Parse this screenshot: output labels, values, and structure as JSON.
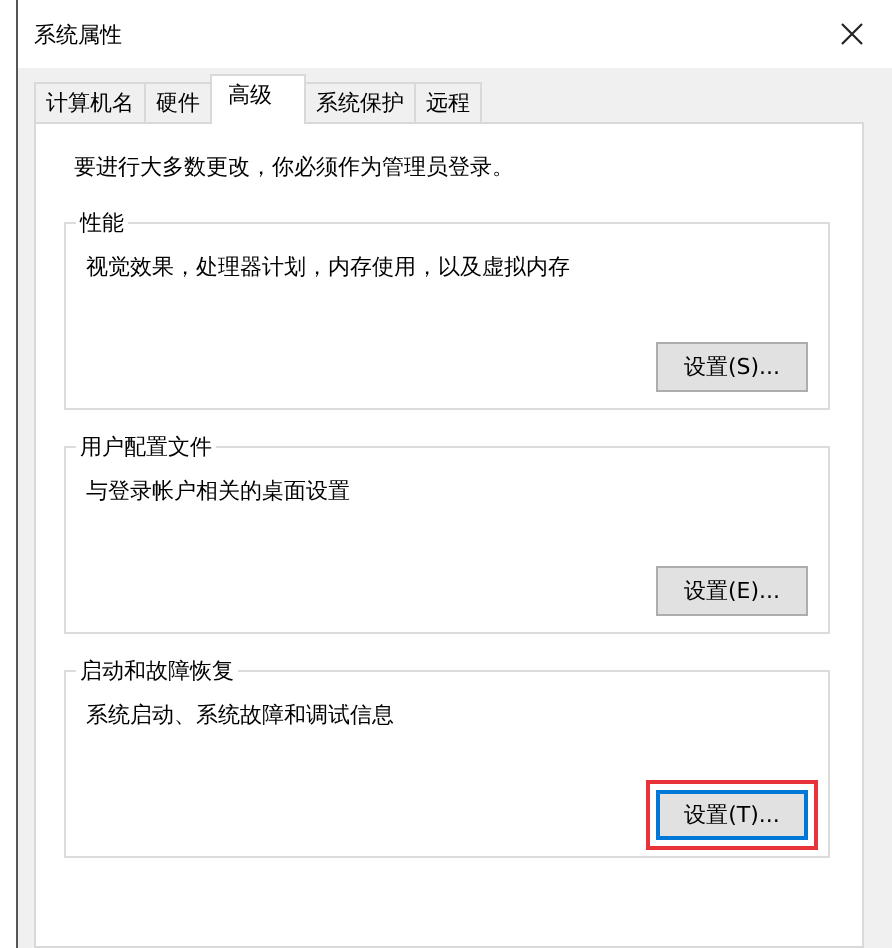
{
  "window": {
    "title": "系统属性"
  },
  "tabs": [
    {
      "label": "计算机名",
      "selected": false
    },
    {
      "label": "硬件",
      "selected": false
    },
    {
      "label": "高级",
      "selected": true
    },
    {
      "label": "系统保护",
      "selected": false
    },
    {
      "label": "远程",
      "selected": false
    }
  ],
  "intro": "要进行大多数更改，你必须作为管理员登录。",
  "groups": [
    {
      "title": "性能",
      "description": "视觉效果，处理器计划，内存使用，以及虚拟内存",
      "button": {
        "label": "设置(S)...",
        "focused": false,
        "highlighted": false
      }
    },
    {
      "title": "用户配置文件",
      "description": "与登录帐户相关的桌面设置",
      "button": {
        "label": "设置(E)...",
        "focused": false,
        "highlighted": false
      }
    },
    {
      "title": "启动和故障恢复",
      "description": "系统启动、系统故障和调试信息",
      "button": {
        "label": "设置(T)...",
        "focused": true,
        "highlighted": true
      }
    }
  ]
}
